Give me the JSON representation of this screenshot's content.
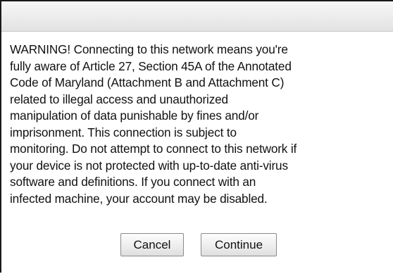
{
  "dialog": {
    "title": "",
    "message": "WARNING! Connecting to this network means you're\nfully aware of Article 27, Section 45A of the Annotated\nCode of Maryland (Attachment B and Attachment C)\nrelated to illegal access and unauthorized\nmanipulation of data punishable by fines and/or\nimprisonment. This connection is subject to\nmonitoring. Do not attempt to connect to this network if\nyour device is not protected with up-to-date anti-virus\nsoftware and definitions. If you connect with an\ninfected machine, your account may be disabled.",
    "cancel_label": "Cancel",
    "continue_label": "Continue"
  }
}
